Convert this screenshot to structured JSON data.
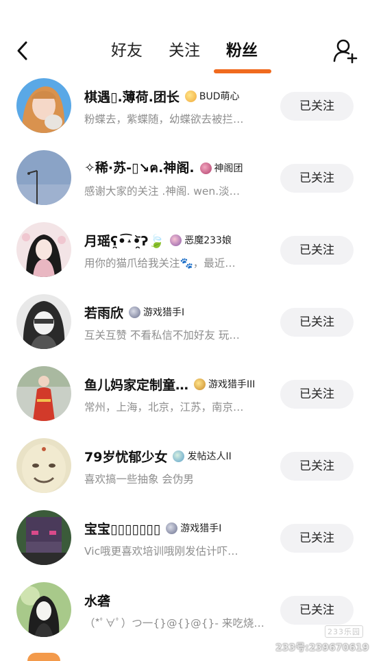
{
  "header": {
    "tabs": [
      {
        "label": "好友",
        "active": false
      },
      {
        "label": "关注",
        "active": false
      },
      {
        "label": "粉丝",
        "active": true
      }
    ],
    "accent_color": "#f06a1e"
  },
  "fans": [
    {
      "name": "棋遇▯.薄荷.团长",
      "badge": "BUD萌心",
      "bio": "粉蝶去，紫蝶随，幼蝶欲去被拦…",
      "button": "已关注"
    },
    {
      "name": "✧稀·苏-▯↘ฅ.神阁.",
      "badge": "神阁团",
      "bio": "感谢大家的关注 .神阁. wen.淡…",
      "button": "已关注"
    },
    {
      "name": "月瑶ʕ̯•͡˔•̯᷅ʔ🍃",
      "badge": "恶魔233娘",
      "bio": "用你的猫爪给我关注🐾，最近…",
      "button": "已关注"
    },
    {
      "name": "若雨欣",
      "badge": "游戏猎手I",
      "bio": "互关互赞 不看私信不加好友 玩…",
      "button": "已关注"
    },
    {
      "name": "鱼儿妈家定制童…",
      "badge": "游戏猎手III",
      "bio": "常州，上海，北京，江苏，南京…",
      "button": "已关注"
    },
    {
      "name": "79岁忧郁少女",
      "badge": "发帖达人II",
      "bio": "喜欢搞一些抽象 会伪男",
      "button": "已关注"
    },
    {
      "name": "宝宝▯▯▯▯▯▯▯",
      "badge": "游戏猎手I",
      "bio": "Vic哦更喜欢培训哦刚发估计吓…",
      "button": "已关注"
    },
    {
      "name": "水砻",
      "badge": "",
      "bio": "（*ﾟ∀ﾟ）つ一{}@{}@{}-  来吃烧…",
      "button": "已关注"
    }
  ],
  "watermark": {
    "logo": "233乐园",
    "id": "233号:239670619"
  }
}
